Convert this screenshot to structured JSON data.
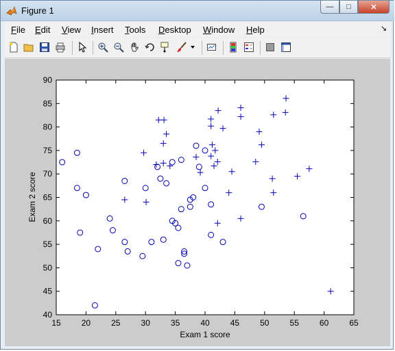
{
  "window": {
    "title": "Figure 1",
    "controls": {
      "minimize": "—",
      "maximize": "□",
      "close": "✕"
    }
  },
  "menu": {
    "items": [
      {
        "label": "File",
        "mnemonic": "F",
        "rest": "ile"
      },
      {
        "label": "Edit",
        "mnemonic": "E",
        "rest": "dit"
      },
      {
        "label": "View",
        "mnemonic": "V",
        "rest": "iew"
      },
      {
        "label": "Insert",
        "mnemonic": "I",
        "rest": "nsert"
      },
      {
        "label": "Tools",
        "mnemonic": "T",
        "rest": "ools"
      },
      {
        "label": "Desktop",
        "mnemonic": "D",
        "rest": "esktop"
      },
      {
        "label": "Window",
        "mnemonic": "W",
        "rest": "indow"
      },
      {
        "label": "Help",
        "mnemonic": "H",
        "rest": "elp"
      }
    ],
    "overflow_icon": "dock-arrow-icon"
  },
  "toolbar": {
    "icons": [
      "new-figure-icon",
      "open-icon",
      "save-icon",
      "print-icon",
      "edit-plot-icon",
      "zoom-in-icon",
      "zoom-out-icon",
      "pan-icon",
      "rotate-3d-icon",
      "data-cursor-icon",
      "brush-icon",
      "brush-dropdown-icon",
      "link-plot-icon",
      "insert-colorbar-icon",
      "insert-legend-icon",
      "hide-plot-tools-icon",
      "show-plot-tools-icon"
    ]
  },
  "colors": {
    "marker": "#0000b4",
    "figure_bg": "#cccccc",
    "axes_bg": "#ffffff"
  },
  "chart_data": {
    "type": "scatter",
    "xlabel": "Exam 1 score",
    "ylabel": "Exam 2 score",
    "xlim": [
      15,
      65
    ],
    "ylim": [
      40,
      90
    ],
    "xticks": [
      15,
      20,
      25,
      30,
      35,
      40,
      45,
      50,
      55,
      60,
      65
    ],
    "yticks": [
      40,
      45,
      50,
      55,
      60,
      65,
      70,
      75,
      80,
      85,
      90
    ],
    "grid": false,
    "series": [
      {
        "marker": "+",
        "x": [
          61.1,
          57.5,
          55.5,
          53.6,
          53.5,
          51.5,
          51.5,
          51.3,
          49.5,
          49.1,
          48.5,
          46.0,
          46.0,
          46.0,
          44.5,
          44.0,
          43.0,
          42.2,
          42.1,
          42.1,
          41.7,
          41.5,
          41.2,
          41.0,
          41.0,
          41.0,
          39.2,
          38.5,
          34.1,
          33.5,
          33.1,
          33.0,
          33.0,
          32.2,
          31.8,
          30.1,
          29.7,
          26.5
        ],
        "y": [
          45.0,
          71.1,
          69.5,
          86.1,
          83.1,
          82.6,
          66.0,
          69.0,
          76.2,
          79.0,
          72.6,
          84.1,
          82.2,
          60.5,
          70.5,
          66.0,
          79.7,
          83.5,
          72.6,
          59.5,
          75.0,
          71.7,
          76.2,
          80.2,
          81.7,
          73.8,
          70.3,
          73.6,
          71.7,
          78.5,
          81.5,
          76.5,
          72.3,
          81.5,
          72.0,
          64.0,
          74.5,
          64.5
        ]
      },
      {
        "marker": "o",
        "x": [
          16.0,
          18.5,
          18.5,
          19.0,
          20.0,
          21.5,
          22.0,
          24.0,
          24.5,
          26.5,
          26.5,
          27.0,
          29.5,
          30.0,
          31.0,
          32.0,
          32.5,
          33.0,
          33.5,
          34.5,
          34.5,
          35.0,
          35.5,
          35.5,
          36.0,
          36.0,
          36.5,
          36.5,
          37.0,
          37.5,
          37.5,
          38.0,
          38.5,
          39.0,
          40.0,
          40.0,
          41.0,
          41.0,
          43.0,
          49.5,
          56.5
        ],
        "y": [
          72.5,
          74.5,
          67.0,
          57.5,
          65.5,
          42.0,
          54.0,
          60.5,
          58.0,
          68.5,
          55.5,
          53.5,
          52.5,
          67.0,
          55.5,
          71.5,
          69.0,
          56.0,
          68.0,
          72.5,
          60.0,
          59.5,
          58.5,
          51.0,
          73.0,
          62.5,
          53.5,
          53.0,
          50.5,
          63.0,
          64.5,
          65.0,
          76.0,
          71.5,
          75.0,
          67.0,
          63.5,
          57.0,
          55.5,
          63.0,
          61.0
        ]
      }
    ]
  }
}
